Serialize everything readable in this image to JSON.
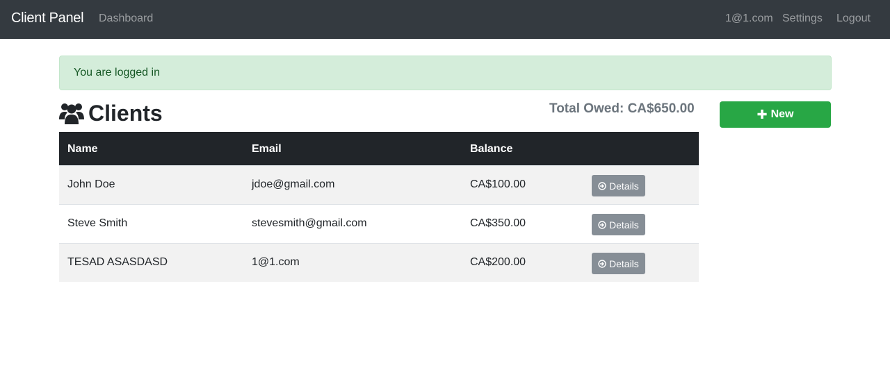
{
  "navbar": {
    "brand": "Client Panel",
    "dashboard": "Dashboard",
    "user": "1@1.com",
    "settings": "Settings",
    "logout": "Logout"
  },
  "alert": {
    "message": "You are logged in"
  },
  "header": {
    "title": "Clients",
    "icon": "users-icon"
  },
  "summary": {
    "total_owed": "Total Owed: CA$650.00"
  },
  "new_button": {
    "label": "New",
    "icon": "plus-icon"
  },
  "table": {
    "headers": [
      "Name",
      "Email",
      "Balance"
    ],
    "rows": [
      {
        "name": "John Doe",
        "email": "jdoe@gmail.com",
        "balance": "CA$100.00",
        "action": "Details"
      },
      {
        "name": "Steve Smith",
        "email": "stevesmith@gmail.com",
        "balance": "CA$350.00",
        "action": "Details"
      },
      {
        "name": "TESAD ASASDASD",
        "email": "1@1.com",
        "balance": "CA$200.00",
        "action": "Details"
      }
    ]
  },
  "colors": {
    "navbar": "#343a40",
    "alert_bg": "#d4edda",
    "alert_text": "#155724",
    "success": "#28a745",
    "secondary": "#868e96",
    "table_header": "#212529"
  }
}
